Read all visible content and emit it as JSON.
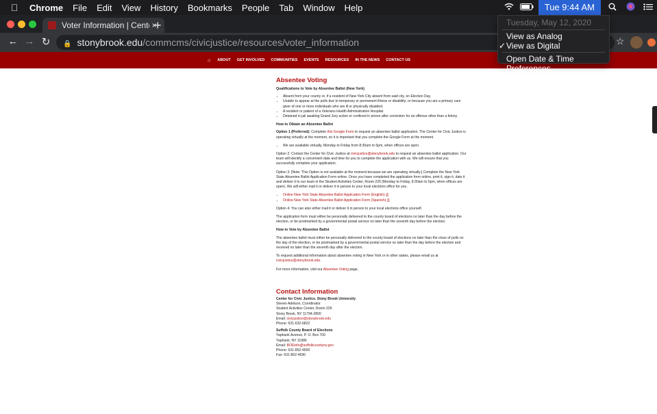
{
  "menubar": {
    "apple_icon": "apple-icon",
    "app_name": "Chrome",
    "menus": [
      "File",
      "Edit",
      "View",
      "History",
      "Bookmarks",
      "People",
      "Tab",
      "Window",
      "Help"
    ],
    "clock": "Tue 9:44 AM",
    "status_icons": [
      "wifi-icon",
      "battery-icon",
      "search-icon",
      "siri-icon",
      "control-list-icon"
    ]
  },
  "clock_menu": {
    "date": "Tuesday, May 12, 2020",
    "options": [
      "View as Analog",
      "View as Digital"
    ],
    "checked": "View as Digital",
    "preferences": "Open Date & Time Preferences..."
  },
  "browser": {
    "tab_title": "Voter Information | Center for C",
    "tab_close": "×",
    "new_tab": "+",
    "url_host": "stonybrook.edu",
    "url_path": "/commcms/civicjustice/resources/voter_information"
  },
  "site_nav": {
    "home_icon": "home-icon",
    "items": [
      "ABOUT",
      "GET INVOLVED",
      "COMMUNITIES",
      "EVENTS",
      "RESOURCES",
      "IN THE NEWS",
      "CONTACT US"
    ]
  },
  "content": {
    "title": "Absentee Voting",
    "qual_heading": "Qualifications to Vote by Absentee Ballot (New York)",
    "qual_items": [
      "Absent from your county or, if a resident of New York City absent from said city, on Election Day.",
      "Unable to appear at the polls due to temporary or permanent illness or disability; or because you are a primary care giver of one or more individuals who are ill or physically disabled.",
      "A resident or patient of a Veterans Health Administration Hospital.",
      "Detained in jail awaiting Grand Jury action or confined in prison after conviction for an offense other than a felony."
    ],
    "obtain_heading": "How to Obtain an Absentee Ballot",
    "opt1_bold": "Option 1 (Preferred):",
    "opt1_pre": " Complete ",
    "opt1_link": "this Google Form",
    "opt1_post": " to request an absentee ballot application. The Center for Civic Justice is operating virtually at the moment, so it is important that you complete the Google Form at the moment.",
    "opt1_bullet": "We are available virtually, Monday to Friday from 8:30am to 5pm, when offices are open.",
    "opt2_pre": "Option 2: Contact the Center for Civic Justice at ",
    "opt2_link": "civicjustice@stonybrook.edu",
    "opt2_post": " to request an absentee ballot application. Our team will identify a convenient date and time for you to complete the application with us. We will ensure that you successfully complete your application.",
    "opt3": "Option 3: [Note: This Option is not available at the moment because we are operating virtually.] Complete the New York State Absentee Ballot Application Form online. Once you have completed the application form online, print it, sign it, date it and deliver it to our team in the Student Activities Center, Room 226 (Monday to Friday, 8:30am to 5pm, when offices are open). We will either mail it or deliver it in person to your local elections office for you.",
    "form_links": [
      "Online New York State Absentee Ballot Application Form (English)",
      "Online New York State Absentee Ballot Application Form (Spanish)"
    ],
    "pdf_icon": "pdf-icon",
    "opt4": "Option 4: You can also either mail it or deliver it in person to your local elections office yourself.",
    "deadline": "The application form must either be personally delivered to the county board of elections no later than the day before the election, or be postmarked by a governmental postal service no later than the seventh day before the election.",
    "vote_heading": "How to Vote by Absentee Ballot",
    "vote_text": "The absentee ballot must either be personally delivered to the county board of elections no later than the close of polls on the day of the election, or be postmarked by a governmental postal service no later than the day before the election and received no later than the seventh day after the election.",
    "request_pre": "To request additional information about absentee voting in New York or in other states, please email us at ",
    "request_link": "civicjustice@stonybrook.edu",
    "request_post": ".",
    "more_pre": "For more information, visit our ",
    "more_link": "Absentee Voting",
    "more_post": " page.",
    "contact_title": "Contact Information",
    "ccj_name": "Center for Civic Justice, Stony Brook University",
    "ccj_lines": [
      "Steven Adelson, Coordinator",
      "Student Activities Center, Room 226",
      "Stony Brook, NY 11794-2800"
    ],
    "ccj_email_label": "Email: ",
    "ccj_email": "civicjustice@stonybrook.edu",
    "ccj_phone": "Phone: 631-632-6822",
    "suffolk_name": "Suffolk County Board of Elections",
    "suffolk_lines": [
      "Yaphank Avenue, P. O. Box 700",
      "Yaphank, NY 11980"
    ],
    "suffolk_email_label": "Email: ",
    "suffolk_email": "BOEinfo@suffolkcountyny.gov",
    "suffolk_phone": "Phone: 631-852-4500",
    "suffolk_fax": "Fax: 631-852-4590"
  },
  "colors": {
    "brand_red": "#990000",
    "link_red": "#b41111",
    "clock_highlight": "#2a63d4",
    "traffic_red": "#ff5f57",
    "traffic_yellow": "#febc2e",
    "traffic_green": "#28c840"
  }
}
